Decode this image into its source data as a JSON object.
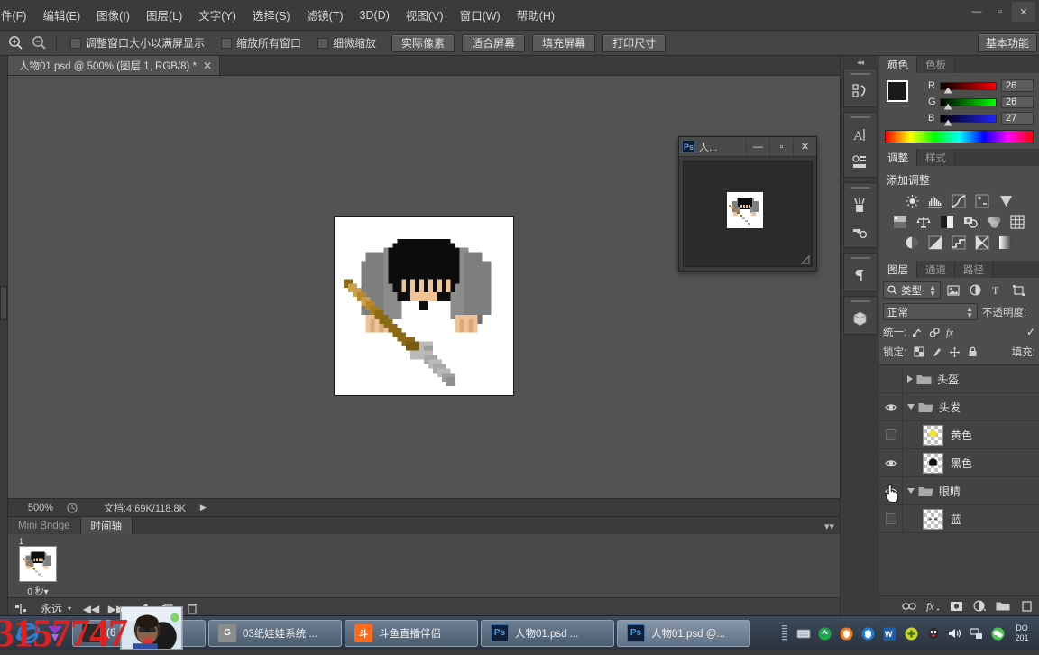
{
  "menubar": {
    "items": [
      "件(F)",
      "编辑(E)",
      "图像(I)",
      "图层(L)",
      "文字(Y)",
      "选择(S)",
      "滤镜(T)",
      "3D(D)",
      "视图(V)",
      "窗口(W)",
      "帮助(H)"
    ],
    "window_controls": {
      "minimize": "—",
      "maximize": "▫",
      "close": "✕"
    }
  },
  "options_bar": {
    "zoom_in_icon": "zoom-in-icon",
    "zoom_out_icon": "zoom-out-icon",
    "checkboxes": [
      {
        "label": "调整窗口大小以满屏显示",
        "checked": false
      },
      {
        "label": "缩放所有窗口",
        "checked": false
      },
      {
        "label": "细微缩放",
        "checked": false
      }
    ],
    "buttons": [
      "实际像素",
      "适合屏幕",
      "填充屏幕",
      "打印尺寸"
    ],
    "workspace": "基本功能"
  },
  "document": {
    "tab_title": "人物01.psd @ 500% (图层 1, RGB/8) *",
    "close_glyph": "✕"
  },
  "statusbar": {
    "zoom": "500%",
    "doc_info": "文档:4.69K/118.8K",
    "arrow": "▶"
  },
  "bottom_dock": {
    "tabs": [
      {
        "label": "Mini Bridge",
        "active": false
      },
      {
        "label": "时间轴",
        "active": true
      }
    ],
    "panel_menu": "▾▾",
    "frame": {
      "number": "1",
      "duration": "0 秒",
      "dropdown": "▾"
    },
    "loop": {
      "value": "永远",
      "caret": "▾"
    },
    "controls": [
      "选择帧方式",
      "◀◀",
      "▶▶",
      "过渡动画帧",
      "复制所选帧",
      "删除所选帧"
    ]
  },
  "rail": {
    "collapse": "◂◂",
    "groups": [
      {
        "icons": [
          "history-icon"
        ]
      },
      {
        "icons": [
          "character-icon",
          "paragraph-style-icon"
        ]
      },
      {
        "icons": [
          "brush-icon",
          "clone-source-icon"
        ]
      },
      {
        "icons": [
          "paragraph-icon"
        ]
      },
      {
        "icons": [
          "3d-cube-icon"
        ]
      }
    ]
  },
  "color_panel": {
    "tabs": [
      {
        "label": "颜色",
        "active": true
      },
      {
        "label": "色板",
        "active": false
      }
    ],
    "foreground": "#1a1a1b",
    "background": "#c79a48",
    "channels": [
      {
        "label": "R",
        "value": "26"
      },
      {
        "label": "G",
        "value": "26"
      },
      {
        "label": "B",
        "value": "27"
      }
    ]
  },
  "adjustments_panel": {
    "tabs": [
      {
        "label": "调整",
        "active": true
      },
      {
        "label": "样式",
        "active": false
      }
    ],
    "title": "添加调整",
    "icons": [
      [
        "brightness-icon",
        "levels-icon",
        "curves-icon",
        "exposure-icon",
        "vibrance-icon"
      ],
      [
        "hue-saturation-icon",
        "color-balance-icon",
        "black-white-icon",
        "photo-filter-icon",
        "channel-mixer-icon",
        "color-lookup-icon"
      ],
      [
        "invert-icon",
        "posterize-icon",
        "threshold-icon",
        "selective-color-icon",
        "gradient-map-icon"
      ]
    ]
  },
  "layers_panel": {
    "tabs": [
      {
        "label": "图层",
        "active": true
      },
      {
        "label": "通道",
        "active": false
      },
      {
        "label": "路径",
        "active": false
      }
    ],
    "filter": {
      "label": "类型",
      "icons": [
        "pixel-filter-icon",
        "adjustment-filter-icon",
        "type-filter-icon",
        "shape-filter-icon"
      ]
    },
    "blend_mode": "正常",
    "opacity_label": "不透明度:",
    "unify_label": "统一:",
    "unify_icons": [
      "unify-position-icon",
      "unify-visibility-icon",
      "unify-style-icon"
    ],
    "unify_checked": true,
    "lock_label": "锁定:",
    "lock_icons": [
      "lock-transparent-icon",
      "lock-image-icon",
      "lock-position-icon",
      "lock-all-icon"
    ],
    "fill_label": "填充:",
    "rows": [
      {
        "name": "头盔",
        "type": "group",
        "expanded": false,
        "visible": false,
        "indent": 0
      },
      {
        "name": "头发",
        "type": "group",
        "expanded": true,
        "visible": true,
        "indent": 0
      },
      {
        "name": "黄色",
        "type": "layer",
        "visible": false,
        "indent": 1,
        "thumb": "yellow-blob"
      },
      {
        "name": "黑色",
        "type": "layer",
        "visible": true,
        "indent": 1,
        "thumb": "black-blob"
      },
      {
        "name": "眼睛",
        "type": "group",
        "expanded": true,
        "visible": true,
        "indent": 0
      },
      {
        "name": "蓝",
        "type": "layer",
        "visible": false,
        "indent": 1,
        "thumb": "eyes"
      }
    ],
    "bottom_icons": [
      "link-layers-icon",
      "layer-fx-icon",
      "add-mask-icon",
      "new-adjustment-icon",
      "new-group-icon",
      "new-layer-icon"
    ]
  },
  "float_window": {
    "app_icon": "Ps",
    "title": "人...",
    "minimize": "—",
    "maximize": "▫",
    "close": "✕"
  },
  "taskbar": {
    "items": [
      {
        "label": "(6",
        "icon": "webcam-app-icon",
        "icon_color": "#2a2a2a",
        "lit": false
      },
      {
        "label": "03纸娃娃系统 ...",
        "icon": "G",
        "icon_color": "#8c8c8c",
        "lit": false
      },
      {
        "label": "斗鱼直播伴侣",
        "icon": "斗",
        "icon_color": "#ff6b1a",
        "lit": false
      },
      {
        "label": "人物01.psd ...",
        "icon": "Ps",
        "icon_color": "#1d3a63",
        "lit": false
      },
      {
        "label": "人物01.psd @...",
        "icon": "Ps",
        "icon_color": "#1d3a63",
        "lit": true
      }
    ],
    "tray_icons": [
      "notebook-icon",
      "recycle-icon",
      "shield-icon",
      "antivirus-icon",
      "wps-icon",
      "plus-icon",
      "qq-icon",
      "volume-icon",
      "network-icon",
      "wechat-icon"
    ],
    "clock_lines": [
      "DQ",
      "201"
    ]
  },
  "watermark": {
    "text": "3157747",
    "color": "#e02020"
  }
}
